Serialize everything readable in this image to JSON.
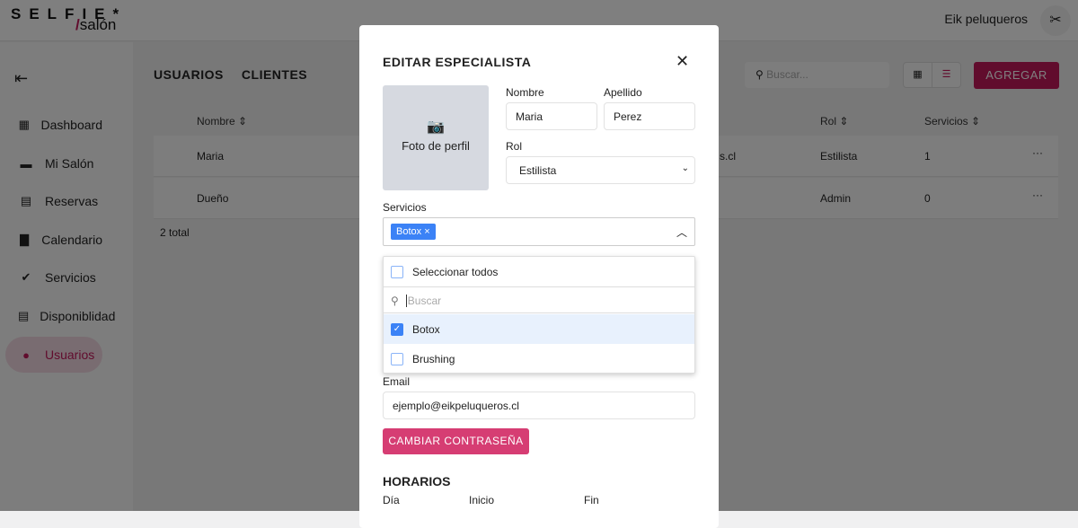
{
  "header": {
    "logo_top": "SELFIE*",
    "logo_bottom_slash": "/",
    "logo_bottom": "salón",
    "user_name": "Eik peluqueros",
    "avatar_icon": "scissors-icon"
  },
  "sidebar": {
    "items": [
      {
        "label": "Dashboard",
        "icon": "dashboard-icon"
      },
      {
        "label": "Mi Salón",
        "icon": "store-icon"
      },
      {
        "label": "Reservas",
        "icon": "clipboard-icon"
      },
      {
        "label": "Calendario",
        "icon": "calendar-icon"
      },
      {
        "label": "Servicios",
        "icon": "badge-check-icon"
      },
      {
        "label": "Disponiblidad",
        "icon": "clipboard-icon"
      },
      {
        "label": "Usuarios",
        "icon": "user-icon"
      }
    ],
    "active": "Usuarios"
  },
  "main": {
    "tabs": [
      "USUARIOS",
      "CLIENTES"
    ],
    "search_placeholder": "Buscar...",
    "add_label": "AGREGAR",
    "columns": [
      "Nombre",
      "Rol",
      "Servicios"
    ],
    "rows": [
      {
        "nombre": "Maria",
        "email_fragment": "s.cl",
        "rol": "Estilista",
        "servicios": "1"
      },
      {
        "nombre": "Dueño",
        "rol": "Admin",
        "servicios": "0"
      }
    ],
    "total": "2 total"
  },
  "modal": {
    "title": "EDITAR ESPECIALISTA",
    "photo_label": "Foto de perfil",
    "nombre_label": "Nombre",
    "nombre": "Maria",
    "apellido_label": "Apellido",
    "apellido": "Perez",
    "rol_label": "Rol",
    "rol": "Estilista",
    "servicios_label": "Servicios",
    "chip": "Botox",
    "dropdown": {
      "select_all": "Seleccionar todos",
      "search_placeholder": "Buscar",
      "options": [
        {
          "label": "Botox",
          "checked": true
        },
        {
          "label": "Brushing",
          "checked": false
        }
      ]
    },
    "email_label": "Email",
    "email": "ejemplo@eikpeluqueros.cl",
    "password_button": "CAMBIAR CONTRASEÑA",
    "horarios": "HORARIOS",
    "hor_cols": [
      "Día",
      "Inicio",
      "Fin"
    ]
  },
  "colors": {
    "accent": "#c2185b",
    "blue": "#3b82f6",
    "password_button": "#d63d73"
  }
}
